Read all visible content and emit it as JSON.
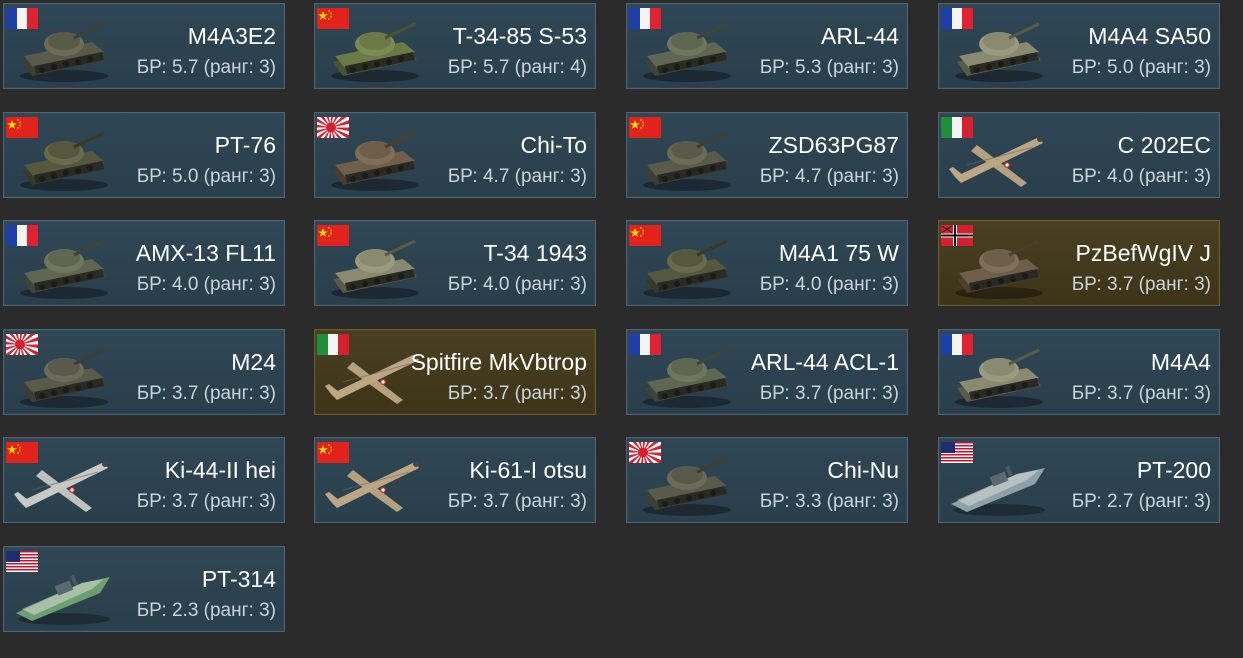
{
  "vehicles": [
    {
      "name": "M4A3E2",
      "br": "БР: 5.7 (ранг: 3)",
      "flag": "france-flag-icon",
      "type": "tank-icon",
      "premium": false
    },
    {
      "name": "T-34-85 S-53",
      "br": "БР: 5.7 (ранг: 4)",
      "flag": "china-flag-icon",
      "type": "tank-icon",
      "premium": false
    },
    {
      "name": "ARL-44",
      "br": "БР: 5.3 (ранг: 3)",
      "flag": "france-flag-icon",
      "type": "tank-icon",
      "premium": false
    },
    {
      "name": "M4A4 SA50",
      "br": "БР: 5.0 (ранг: 3)",
      "flag": "france-flag-icon",
      "type": "tank-icon",
      "premium": false
    },
    {
      "name": "PT-76",
      "br": "БР: 5.0 (ранг: 3)",
      "flag": "china-flag-icon",
      "type": "tank-icon",
      "premium": false
    },
    {
      "name": "Chi-To",
      "br": "БР: 4.7 (ранг: 3)",
      "flag": "japan-flag-icon",
      "type": "tank-icon",
      "premium": false
    },
    {
      "name": "ZSD63PG87",
      "br": "БР: 4.7 (ранг: 3)",
      "flag": "china-flag-icon",
      "type": "tank-icon",
      "premium": false
    },
    {
      "name": "C 202EC",
      "br": "БР: 4.0 (ранг: 3)",
      "flag": "italy-flag-icon",
      "type": "plane-icon",
      "premium": false
    },
    {
      "name": "AMX-13 FL11",
      "br": "БР: 4.0 (ранг: 3)",
      "flag": "france-flag-icon",
      "type": "tank-icon",
      "premium": false
    },
    {
      "name": "T-34 1943",
      "br": "БР: 4.0 (ранг: 3)",
      "flag": "china-flag-icon",
      "type": "tank-icon",
      "premium": false
    },
    {
      "name": "M4A1 75 W",
      "br": "БР: 4.0 (ранг: 3)",
      "flag": "china-flag-icon",
      "type": "tank-icon",
      "premium": false
    },
    {
      "name": "PzBefWgIV J",
      "br": "БР: 3.7 (ранг: 3)",
      "flag": "germany-flag-icon",
      "type": "tank-icon",
      "premium": true
    },
    {
      "name": "M24",
      "br": "БР: 3.7 (ранг: 3)",
      "flag": "japan-flag-icon",
      "type": "tank-icon",
      "premium": false
    },
    {
      "name": "Spitfire MkVbtrop",
      "br": "БР: 3.7 (ранг: 3)",
      "flag": "italy-flag-icon",
      "type": "plane-icon",
      "premium": true
    },
    {
      "name": "ARL-44 ACL-1",
      "br": "БР: 3.7 (ранг: 3)",
      "flag": "france-flag-icon",
      "type": "tank-icon",
      "premium": false
    },
    {
      "name": "M4A4",
      "br": "БР: 3.7 (ранг: 3)",
      "flag": "france-flag-icon",
      "type": "tank-icon",
      "premium": false
    },
    {
      "name": "Ki-44-II hei",
      "br": "БР: 3.7 (ранг: 3)",
      "flag": "china-flag-icon",
      "type": "plane-icon",
      "premium": false
    },
    {
      "name": "Ki-61-I otsu",
      "br": "БР: 3.7 (ранг: 3)",
      "flag": "china-flag-icon",
      "type": "plane-icon",
      "premium": false
    },
    {
      "name": "Chi-Nu",
      "br": "БР: 3.3 (ранг: 3)",
      "flag": "japan-flag-icon",
      "type": "tank-icon",
      "premium": false
    },
    {
      "name": "PT-200",
      "br": "БР: 2.7 (ранг: 3)",
      "flag": "usa-flag-icon",
      "type": "boat-icon",
      "premium": false
    },
    {
      "name": "PT-314",
      "br": "БР: 2.3 (ранг: 3)",
      "flag": "usa-flag-icon",
      "type": "boat-icon",
      "premium": false
    }
  ],
  "colors": {
    "background": "#2b2b2b",
    "card": "#2f4654",
    "card_border": "#4d6371",
    "premium_card": "#4a3f20",
    "premium_border": "#6b5a2c",
    "name_text": "#ffffff",
    "br_text": "#c9d3d9"
  }
}
